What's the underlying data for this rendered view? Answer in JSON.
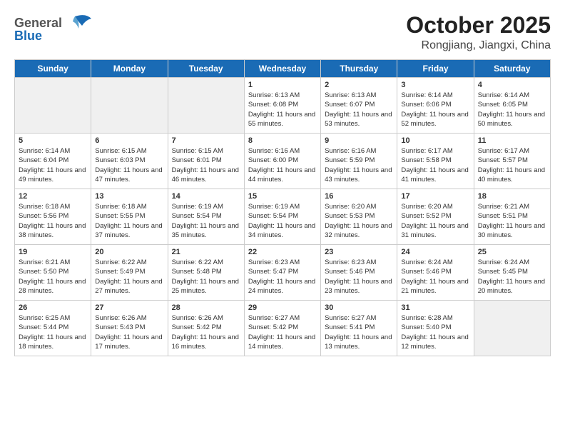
{
  "header": {
    "logo_line1": "General",
    "logo_line2": "Blue",
    "month": "October 2025",
    "location": "Rongjiang, Jiangxi, China"
  },
  "weekdays": [
    "Sunday",
    "Monday",
    "Tuesday",
    "Wednesday",
    "Thursday",
    "Friday",
    "Saturday"
  ],
  "weeks": [
    [
      {
        "day": "",
        "sunrise": "",
        "sunset": "",
        "daylight": "",
        "empty": true
      },
      {
        "day": "",
        "sunrise": "",
        "sunset": "",
        "daylight": "",
        "empty": true
      },
      {
        "day": "",
        "sunrise": "",
        "sunset": "",
        "daylight": "",
        "empty": true
      },
      {
        "day": "1",
        "sunrise": "Sunrise: 6:13 AM",
        "sunset": "Sunset: 6:08 PM",
        "daylight": "Daylight: 11 hours and 55 minutes."
      },
      {
        "day": "2",
        "sunrise": "Sunrise: 6:13 AM",
        "sunset": "Sunset: 6:07 PM",
        "daylight": "Daylight: 11 hours and 53 minutes."
      },
      {
        "day": "3",
        "sunrise": "Sunrise: 6:14 AM",
        "sunset": "Sunset: 6:06 PM",
        "daylight": "Daylight: 11 hours and 52 minutes."
      },
      {
        "day": "4",
        "sunrise": "Sunrise: 6:14 AM",
        "sunset": "Sunset: 6:05 PM",
        "daylight": "Daylight: 11 hours and 50 minutes."
      }
    ],
    [
      {
        "day": "5",
        "sunrise": "Sunrise: 6:14 AM",
        "sunset": "Sunset: 6:04 PM",
        "daylight": "Daylight: 11 hours and 49 minutes."
      },
      {
        "day": "6",
        "sunrise": "Sunrise: 6:15 AM",
        "sunset": "Sunset: 6:03 PM",
        "daylight": "Daylight: 11 hours and 47 minutes."
      },
      {
        "day": "7",
        "sunrise": "Sunrise: 6:15 AM",
        "sunset": "Sunset: 6:01 PM",
        "daylight": "Daylight: 11 hours and 46 minutes."
      },
      {
        "day": "8",
        "sunrise": "Sunrise: 6:16 AM",
        "sunset": "Sunset: 6:00 PM",
        "daylight": "Daylight: 11 hours and 44 minutes."
      },
      {
        "day": "9",
        "sunrise": "Sunrise: 6:16 AM",
        "sunset": "Sunset: 5:59 PM",
        "daylight": "Daylight: 11 hours and 43 minutes."
      },
      {
        "day": "10",
        "sunrise": "Sunrise: 6:17 AM",
        "sunset": "Sunset: 5:58 PM",
        "daylight": "Daylight: 11 hours and 41 minutes."
      },
      {
        "day": "11",
        "sunrise": "Sunrise: 6:17 AM",
        "sunset": "Sunset: 5:57 PM",
        "daylight": "Daylight: 11 hours and 40 minutes."
      }
    ],
    [
      {
        "day": "12",
        "sunrise": "Sunrise: 6:18 AM",
        "sunset": "Sunset: 5:56 PM",
        "daylight": "Daylight: 11 hours and 38 minutes."
      },
      {
        "day": "13",
        "sunrise": "Sunrise: 6:18 AM",
        "sunset": "Sunset: 5:55 PM",
        "daylight": "Daylight: 11 hours and 37 minutes."
      },
      {
        "day": "14",
        "sunrise": "Sunrise: 6:19 AM",
        "sunset": "Sunset: 5:54 PM",
        "daylight": "Daylight: 11 hours and 35 minutes."
      },
      {
        "day": "15",
        "sunrise": "Sunrise: 6:19 AM",
        "sunset": "Sunset: 5:54 PM",
        "daylight": "Daylight: 11 hours and 34 minutes."
      },
      {
        "day": "16",
        "sunrise": "Sunrise: 6:20 AM",
        "sunset": "Sunset: 5:53 PM",
        "daylight": "Daylight: 11 hours and 32 minutes."
      },
      {
        "day": "17",
        "sunrise": "Sunrise: 6:20 AM",
        "sunset": "Sunset: 5:52 PM",
        "daylight": "Daylight: 11 hours and 31 minutes."
      },
      {
        "day": "18",
        "sunrise": "Sunrise: 6:21 AM",
        "sunset": "Sunset: 5:51 PM",
        "daylight": "Daylight: 11 hours and 30 minutes."
      }
    ],
    [
      {
        "day": "19",
        "sunrise": "Sunrise: 6:21 AM",
        "sunset": "Sunset: 5:50 PM",
        "daylight": "Daylight: 11 hours and 28 minutes."
      },
      {
        "day": "20",
        "sunrise": "Sunrise: 6:22 AM",
        "sunset": "Sunset: 5:49 PM",
        "daylight": "Daylight: 11 hours and 27 minutes."
      },
      {
        "day": "21",
        "sunrise": "Sunrise: 6:22 AM",
        "sunset": "Sunset: 5:48 PM",
        "daylight": "Daylight: 11 hours and 25 minutes."
      },
      {
        "day": "22",
        "sunrise": "Sunrise: 6:23 AM",
        "sunset": "Sunset: 5:47 PM",
        "daylight": "Daylight: 11 hours and 24 minutes."
      },
      {
        "day": "23",
        "sunrise": "Sunrise: 6:23 AM",
        "sunset": "Sunset: 5:46 PM",
        "daylight": "Daylight: 11 hours and 23 minutes."
      },
      {
        "day": "24",
        "sunrise": "Sunrise: 6:24 AM",
        "sunset": "Sunset: 5:46 PM",
        "daylight": "Daylight: 11 hours and 21 minutes."
      },
      {
        "day": "25",
        "sunrise": "Sunrise: 6:24 AM",
        "sunset": "Sunset: 5:45 PM",
        "daylight": "Daylight: 11 hours and 20 minutes."
      }
    ],
    [
      {
        "day": "26",
        "sunrise": "Sunrise: 6:25 AM",
        "sunset": "Sunset: 5:44 PM",
        "daylight": "Daylight: 11 hours and 18 minutes."
      },
      {
        "day": "27",
        "sunrise": "Sunrise: 6:26 AM",
        "sunset": "Sunset: 5:43 PM",
        "daylight": "Daylight: 11 hours and 17 minutes."
      },
      {
        "day": "28",
        "sunrise": "Sunrise: 6:26 AM",
        "sunset": "Sunset: 5:42 PM",
        "daylight": "Daylight: 11 hours and 16 minutes."
      },
      {
        "day": "29",
        "sunrise": "Sunrise: 6:27 AM",
        "sunset": "Sunset: 5:42 PM",
        "daylight": "Daylight: 11 hours and 14 minutes."
      },
      {
        "day": "30",
        "sunrise": "Sunrise: 6:27 AM",
        "sunset": "Sunset: 5:41 PM",
        "daylight": "Daylight: 11 hours and 13 minutes."
      },
      {
        "day": "31",
        "sunrise": "Sunrise: 6:28 AM",
        "sunset": "Sunset: 5:40 PM",
        "daylight": "Daylight: 11 hours and 12 minutes."
      },
      {
        "day": "",
        "sunrise": "",
        "sunset": "",
        "daylight": "",
        "empty": true
      }
    ]
  ]
}
